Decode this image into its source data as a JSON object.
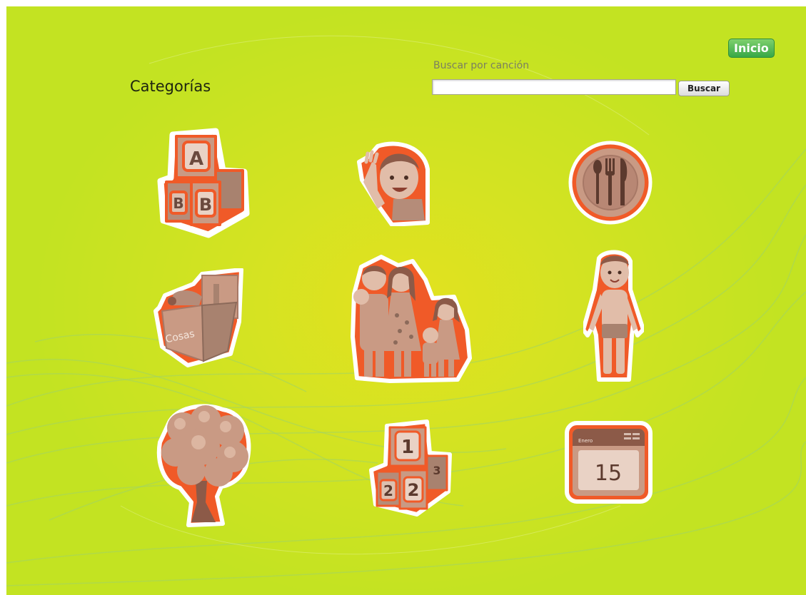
{
  "header": {
    "home_label": "Inicio",
    "title": "Categorías"
  },
  "search": {
    "label": "Buscar por canción",
    "value": "",
    "placeholder": "",
    "button_label": "Buscar"
  },
  "categories": [
    {
      "icon": "alphabet-blocks-icon",
      "letters": [
        "A",
        "B",
        "B"
      ]
    },
    {
      "icon": "waving-boy-icon"
    },
    {
      "icon": "plate-cutlery-icon"
    },
    {
      "icon": "toy-box-icon",
      "box_label": "Cosas"
    },
    {
      "icon": "family-icon"
    },
    {
      "icon": "child-body-icon"
    },
    {
      "icon": "tree-icon"
    },
    {
      "icon": "number-blocks-icon",
      "numbers": [
        "1",
        "2",
        "2",
        "3"
      ]
    },
    {
      "icon": "calendar-icon",
      "month": "Enero",
      "day": "15"
    }
  ],
  "colors": {
    "background": "#d4e322",
    "icon_fill": "#c99a84",
    "icon_outline": "#f05a28",
    "home_button": "#4cb85a"
  }
}
